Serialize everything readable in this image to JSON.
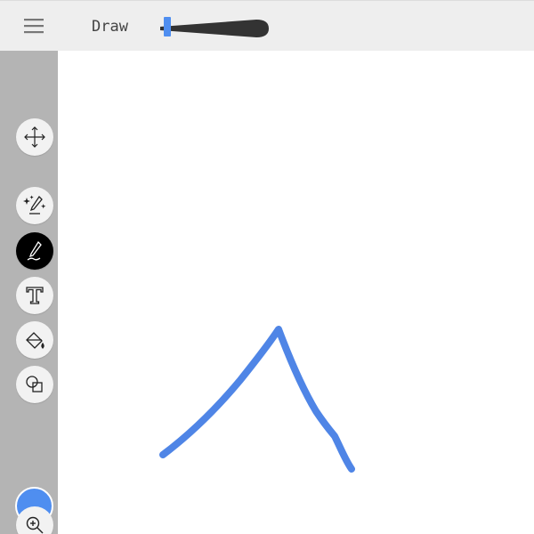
{
  "toolbar": {
    "mode_label": "Draw",
    "menu_icon": "hamburger-menu-icon",
    "brush_width_icon": "brush-width-slider"
  },
  "tools": [
    {
      "name": "move",
      "icon": "move-arrows-icon",
      "active": false
    },
    {
      "name": "magic-pen",
      "icon": "sparkle-pen-icon",
      "active": false
    },
    {
      "name": "pen",
      "icon": "pen-icon",
      "active": true
    },
    {
      "name": "text",
      "icon": "text-icon",
      "active": false
    },
    {
      "name": "fill",
      "icon": "paint-bucket-icon",
      "active": false
    },
    {
      "name": "shapes",
      "icon": "shapes-icon",
      "active": false
    },
    {
      "name": "zoom",
      "icon": "zoom-in-icon",
      "active": false
    }
  ],
  "colors": {
    "accent": "#4f8ef0",
    "stroke": "#4f85e6",
    "topbar": "#eeeeee",
    "sidebar": "#b4b4b4"
  }
}
